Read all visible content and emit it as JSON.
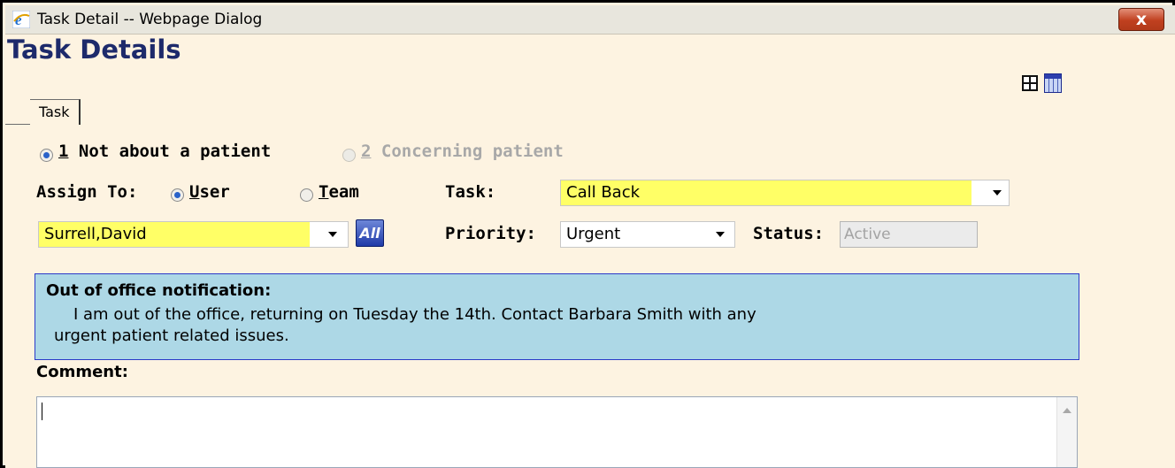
{
  "window": {
    "title": "Task Detail -- Webpage Dialog",
    "close_glyph": "x"
  },
  "page": {
    "title": "Task Details",
    "tab_label": "Task"
  },
  "patient_type": {
    "option1_num": "1",
    "option1_text": " Not about a patient",
    "option2_num": "2",
    "option2_text": " Concerning patient",
    "selected": "1"
  },
  "assign": {
    "label": "Assign To:",
    "user_u": "U",
    "user_rest": "ser",
    "team_u": "T",
    "team_rest": "eam",
    "selected": "User",
    "assignee_value": "Surrell,David",
    "all_button": "All"
  },
  "task": {
    "label": "Task:",
    "value": "Call Back"
  },
  "priority": {
    "label": "Priority:",
    "value": "Urgent"
  },
  "status": {
    "label": "Status:",
    "value": "Active"
  },
  "notification": {
    "title": "Out of office notification:",
    "line1": "I am out of the office, returning on Tuesday the 14th. Contact Barbara Smith with any",
    "line2": "urgent patient related issues."
  },
  "comment": {
    "label": "Comment:",
    "value": ""
  },
  "icons": {
    "window_icon": "ie-icon",
    "layout_toggle": "layout-icon",
    "calendar": "calendar-grid-icon"
  },
  "colors": {
    "background": "#fdf3e1",
    "highlight": "#ffff66",
    "notification_bg": "#add8e6",
    "title_color": "#1d2a6b"
  }
}
